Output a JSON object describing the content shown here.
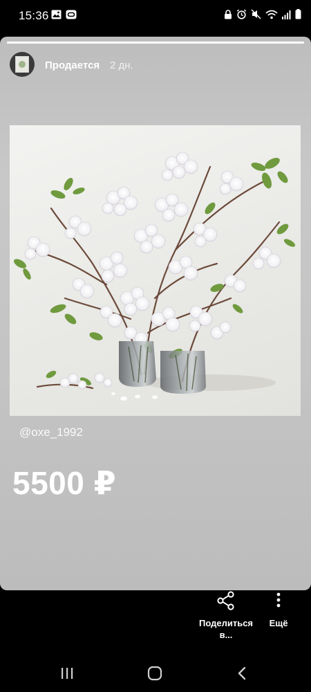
{
  "status_bar": {
    "time": "15:36"
  },
  "story": {
    "author": "Продается",
    "time_ago": "2 дн.",
    "progress": 1.0,
    "mention": "@oxe_1992",
    "price": "5500 ₽"
  },
  "actions": {
    "share_label": "Поделиться в...",
    "more_label": "Ещё"
  }
}
